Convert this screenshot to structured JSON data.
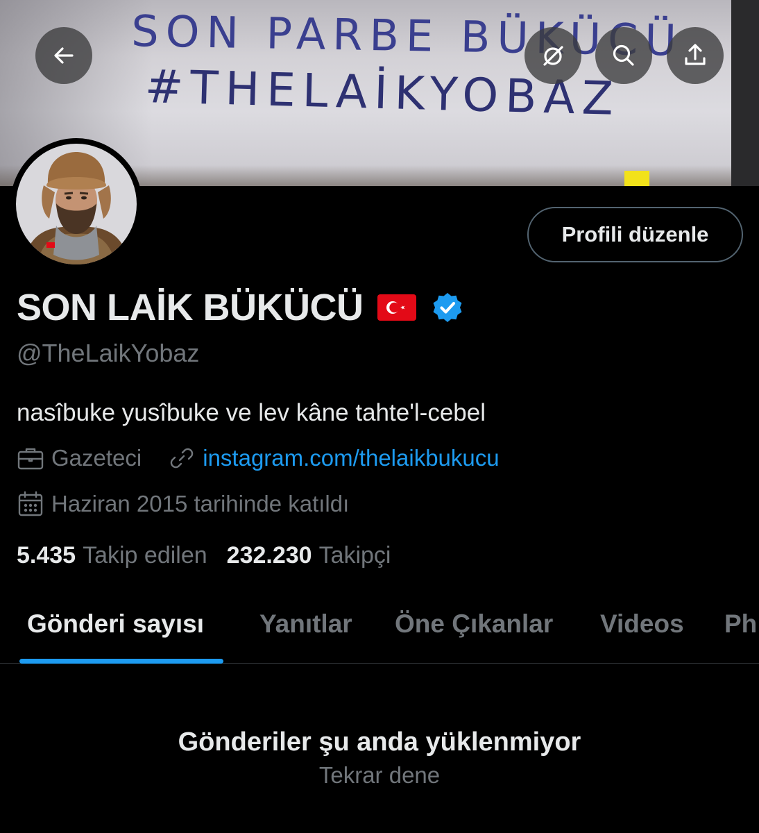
{
  "banner": {
    "graffiti_line1": "SON PARBE BÜKÜCÜ",
    "graffiti_line2": "#THELAİKYOBAZ"
  },
  "nav": {
    "back_icon": "arrow-left-icon",
    "right_icons": [
      "grok-icon",
      "search-icon",
      "share-icon"
    ]
  },
  "profile": {
    "edit_label": "Profili düzenle",
    "display_name": "SON LAİK BÜKÜCÜ",
    "flag_icon": "turkey-flag-icon",
    "verified_icon": "verified-badge-icon",
    "verified_color": "#1d9bf0",
    "handle": "@TheLaikYobaz",
    "bio": "nasîbuke yusîbuke ve lev kâne tahte'l-cebel",
    "profession": "Gazeteci",
    "website": "instagram.com/thelaikbukucu",
    "joined": "Haziran 2015 tarihinde katıldı",
    "following_count": "5.435",
    "following_label": "Takip edilen",
    "followers_count": "232.230",
    "followers_label": "Takipçi"
  },
  "tabs": [
    {
      "label": "Gönderi sayısı",
      "active": true
    },
    {
      "label": "Yanıtlar",
      "active": false
    },
    {
      "label": "Öne Çıkanlar",
      "active": false
    },
    {
      "label": "Videos",
      "active": false
    },
    {
      "label": "Ph",
      "active": false
    }
  ],
  "feed": {
    "error_title": "Gönderiler şu anda yüklenmiyor",
    "retry_label": "Tekrar dene"
  },
  "colors": {
    "accent": "#1d9bf0",
    "background": "#000000",
    "muted_text": "#71767b"
  }
}
